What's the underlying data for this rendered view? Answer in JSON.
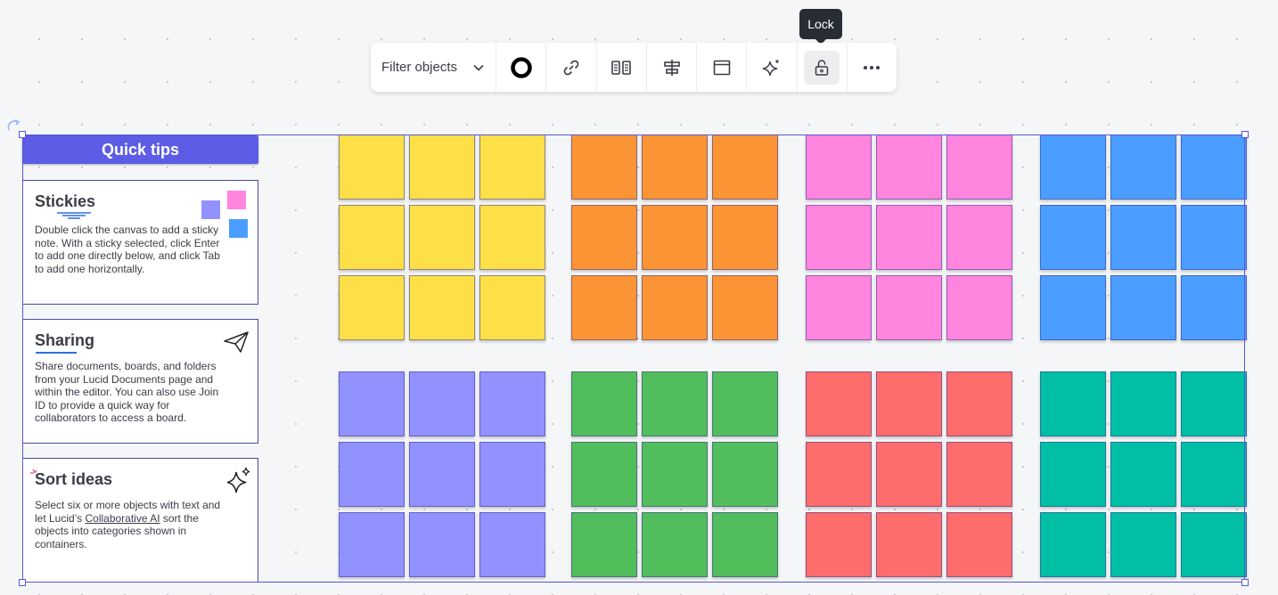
{
  "toolbar": {
    "filter_label": "Filter objects",
    "tooltip": "Lock",
    "buttons": [
      {
        "name": "border-style-button",
        "icon": "circle-outline-icon"
      },
      {
        "name": "link-button",
        "icon": "link-icon"
      },
      {
        "name": "distribute-columns-button",
        "icon": "columns-icon"
      },
      {
        "name": "distribute-rows-button",
        "icon": "rows-icon"
      },
      {
        "name": "container-button",
        "icon": "container-icon"
      },
      {
        "name": "ai-sparkle-button",
        "icon": "sparkle-icon"
      },
      {
        "name": "lock-button",
        "icon": "unlock-icon"
      },
      {
        "name": "more-button",
        "icon": "more-icon"
      }
    ]
  },
  "tips": {
    "header": "Quick tips",
    "cards": [
      {
        "title": "Stickies",
        "desc": "Double click the canvas to add a sticky note. With a sticky selected, click Enter to add one directly below, and click Tab to add one horizontally."
      },
      {
        "title": "Sharing",
        "desc": "Share documents, boards, and folders from your Lucid Documents page and within the editor. You can also use Join ID to provide a quick way for collaborators to access a board."
      },
      {
        "title": "Sort ideas",
        "desc_before": "Select six or more objects with text and let Lucid’s ",
        "desc_link": "Collaborative AI",
        "desc_after": " sort the objects into categories shown in containers."
      }
    ]
  },
  "sticky_groups": [
    {
      "color": "#fde047",
      "row": 0,
      "col": 0
    },
    {
      "color": "#fb9435",
      "row": 0,
      "col": 1
    },
    {
      "color": "#ff85de",
      "row": 0,
      "col": 2
    },
    {
      "color": "#4b9eff",
      "row": 0,
      "col": 3
    },
    {
      "color": "#9191ff",
      "row": 1,
      "col": 0
    },
    {
      "color": "#52bd5c",
      "row": 1,
      "col": 1
    },
    {
      "color": "#fe6c6c",
      "row": 1,
      "col": 2
    },
    {
      "color": "#00bfa4",
      "row": 1,
      "col": 3
    }
  ]
}
